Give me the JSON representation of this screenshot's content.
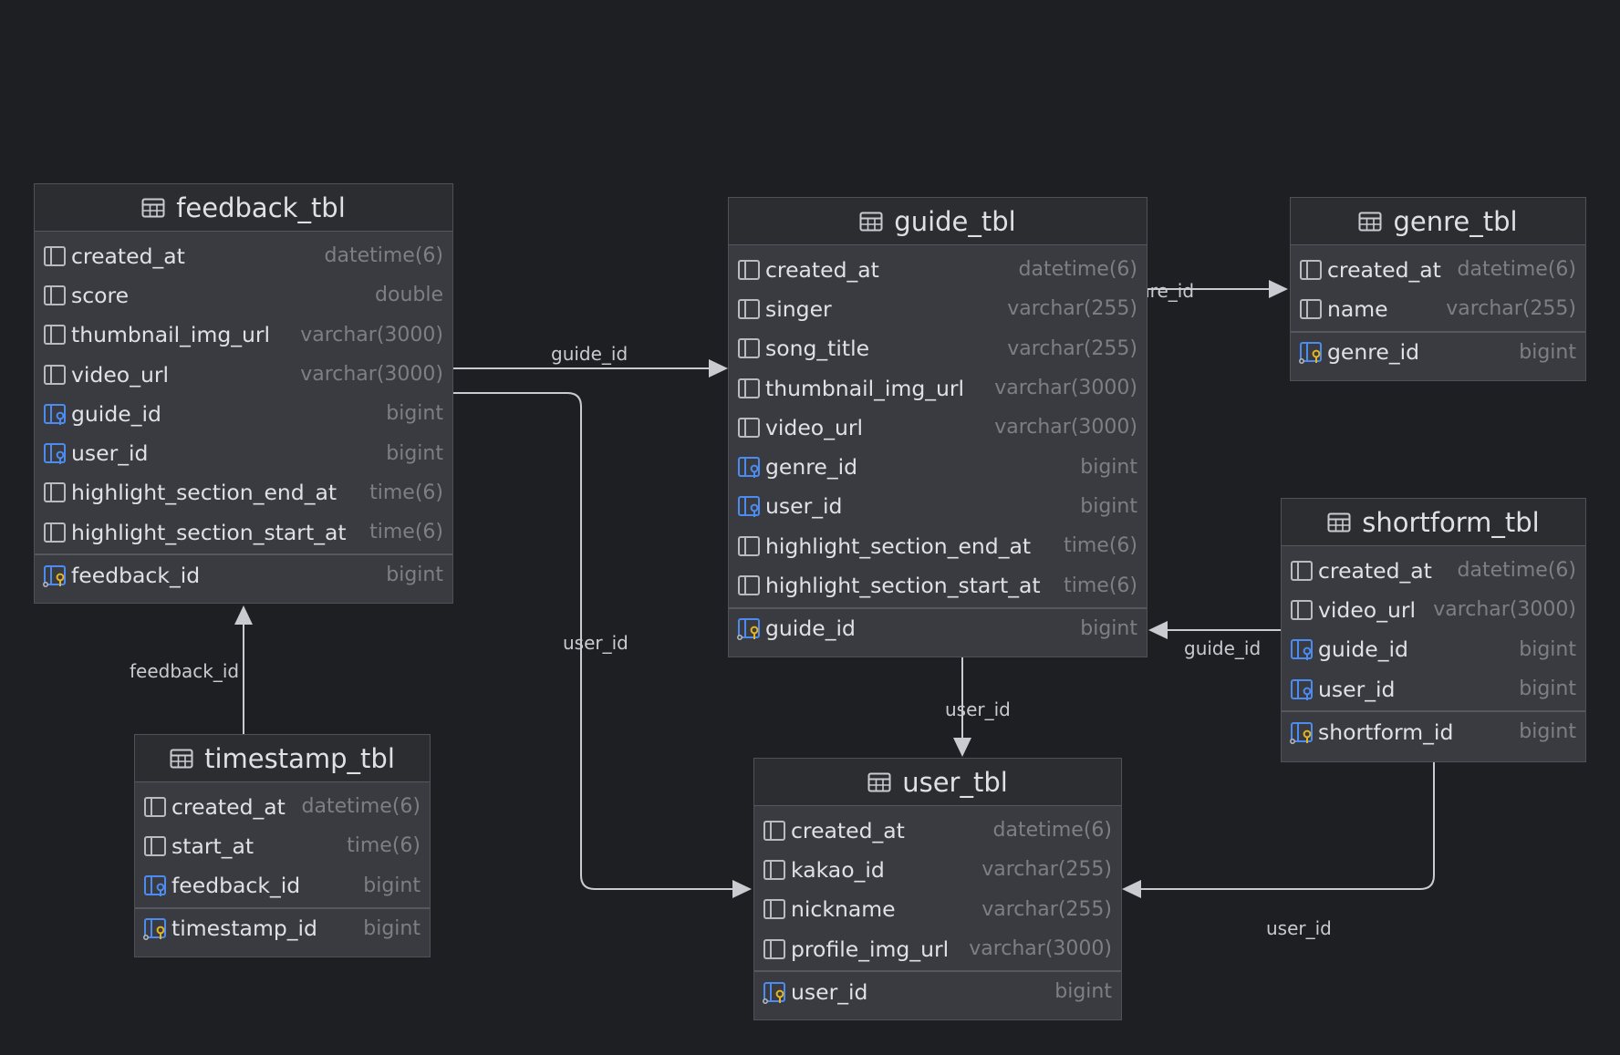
{
  "colors": {
    "background": "#1e1f22",
    "table_body": "#393b40",
    "table_header": "#2b2d30",
    "column_text": "#dfe1e5",
    "type_text": "#7c7f86",
    "edge": "#c9cbd0",
    "fk_icon": "#4c8cf0",
    "pk_icon": "#e6b422"
  },
  "tables": {
    "feedback": {
      "title": "feedback_tbl",
      "icon": "table-icon",
      "columns": [
        {
          "name": "created_at",
          "type": "datetime(6)",
          "icon": "column-icon"
        },
        {
          "name": "score",
          "type": "double",
          "icon": "column-icon"
        },
        {
          "name": "thumbnail_img_url",
          "type": "varchar(3000)",
          "icon": "column-icon"
        },
        {
          "name": "video_url",
          "type": "varchar(3000)",
          "icon": "column-icon"
        },
        {
          "name": "guide_id",
          "type": "bigint",
          "icon": "foreign-key-icon"
        },
        {
          "name": "user_id",
          "type": "bigint",
          "icon": "foreign-key-icon"
        },
        {
          "name": "highlight_section_end_at",
          "type": "time(6)",
          "icon": "column-icon"
        },
        {
          "name": "highlight_section_start_at",
          "type": "time(6)",
          "icon": "column-icon"
        }
      ],
      "key": {
        "name": "feedback_id",
        "type": "bigint",
        "icon": "primary-key-icon"
      }
    },
    "guide": {
      "title": "guide_tbl",
      "icon": "table-icon",
      "columns": [
        {
          "name": "created_at",
          "type": "datetime(6)",
          "icon": "column-icon"
        },
        {
          "name": "singer",
          "type": "varchar(255)",
          "icon": "column-icon"
        },
        {
          "name": "song_title",
          "type": "varchar(255)",
          "icon": "column-icon"
        },
        {
          "name": "thumbnail_img_url",
          "type": "varchar(3000)",
          "icon": "column-icon"
        },
        {
          "name": "video_url",
          "type": "varchar(3000)",
          "icon": "column-icon"
        },
        {
          "name": "genre_id",
          "type": "bigint",
          "icon": "foreign-key-icon"
        },
        {
          "name": "user_id",
          "type": "bigint",
          "icon": "foreign-key-icon"
        },
        {
          "name": "highlight_section_end_at",
          "type": "time(6)",
          "icon": "column-icon"
        },
        {
          "name": "highlight_section_start_at",
          "type": "time(6)",
          "icon": "column-icon"
        }
      ],
      "key": {
        "name": "guide_id",
        "type": "bigint",
        "icon": "primary-key-icon"
      }
    },
    "genre": {
      "title": "genre_tbl",
      "icon": "table-icon",
      "columns": [
        {
          "name": "created_at",
          "type": "datetime(6)",
          "icon": "column-icon"
        },
        {
          "name": "name",
          "type": "varchar(255)",
          "icon": "column-icon"
        }
      ],
      "key": {
        "name": "genre_id",
        "type": "bigint",
        "icon": "primary-key-icon"
      }
    },
    "shortform": {
      "title": "shortform_tbl",
      "icon": "table-icon",
      "columns": [
        {
          "name": "created_at",
          "type": "datetime(6)",
          "icon": "column-icon"
        },
        {
          "name": "video_url",
          "type": "varchar(3000)",
          "icon": "column-icon"
        },
        {
          "name": "guide_id",
          "type": "bigint",
          "icon": "foreign-key-icon"
        },
        {
          "name": "user_id",
          "type": "bigint",
          "icon": "foreign-key-icon"
        }
      ],
      "key": {
        "name": "shortform_id",
        "type": "bigint",
        "icon": "primary-key-icon"
      }
    },
    "timestamp": {
      "title": "timestamp_tbl",
      "icon": "table-icon",
      "columns": [
        {
          "name": "created_at",
          "type": "datetime(6)",
          "icon": "column-icon"
        },
        {
          "name": "start_at",
          "type": "time(6)",
          "icon": "column-icon"
        },
        {
          "name": "feedback_id",
          "type": "bigint",
          "icon": "foreign-key-icon"
        }
      ],
      "key": {
        "name": "timestamp_id",
        "type": "bigint",
        "icon": "primary-key-icon"
      }
    },
    "user": {
      "title": "user_tbl",
      "icon": "table-icon",
      "columns": [
        {
          "name": "created_at",
          "type": "datetime(6)",
          "icon": "column-icon"
        },
        {
          "name": "kakao_id",
          "type": "varchar(255)",
          "icon": "column-icon"
        },
        {
          "name": "nickname",
          "type": "varchar(255)",
          "icon": "column-icon"
        },
        {
          "name": "profile_img_url",
          "type": "varchar(3000)",
          "icon": "column-icon"
        }
      ],
      "key": {
        "name": "user_id",
        "type": "bigint",
        "icon": "primary-key-icon"
      }
    }
  },
  "relationships": [
    {
      "label": "guide_id",
      "from": "feedback_tbl",
      "to": "guide_tbl"
    },
    {
      "label": "user_id",
      "from": "feedback_tbl",
      "to": "user_tbl"
    },
    {
      "label": "genre_id",
      "from": "guide_tbl",
      "to": "genre_tbl"
    },
    {
      "label": "user_id",
      "from": "guide_tbl",
      "to": "user_tbl"
    },
    {
      "label": "guide_id",
      "from": "shortform_tbl",
      "to": "guide_tbl"
    },
    {
      "label": "user_id",
      "from": "shortform_tbl",
      "to": "user_tbl"
    },
    {
      "label": "feedback_id",
      "from": "timestamp_tbl",
      "to": "feedback_tbl"
    }
  ]
}
